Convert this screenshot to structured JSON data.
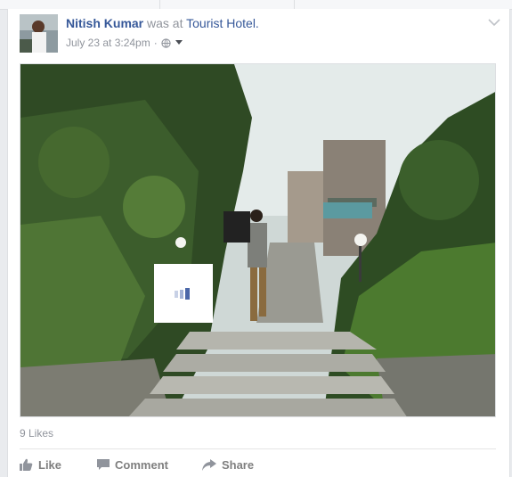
{
  "post": {
    "author": "Nitish Kumar",
    "action_text": "was at",
    "place": "Tourist Hotel.",
    "timestamp": "July 23 at 3:24pm",
    "separator": "·",
    "privacy_icon": "globe-icon",
    "audience_icon": "caret-down-icon",
    "menu_icon": "chevron-down-icon"
  },
  "likes": {
    "text": "9 Likes"
  },
  "actions": {
    "like_label": "Like",
    "comment_label": "Comment",
    "share_label": "Share"
  },
  "colors": {
    "link": "#365899",
    "meta": "#90949c",
    "action": "#7f7f7f",
    "background": "#e9ebee"
  }
}
